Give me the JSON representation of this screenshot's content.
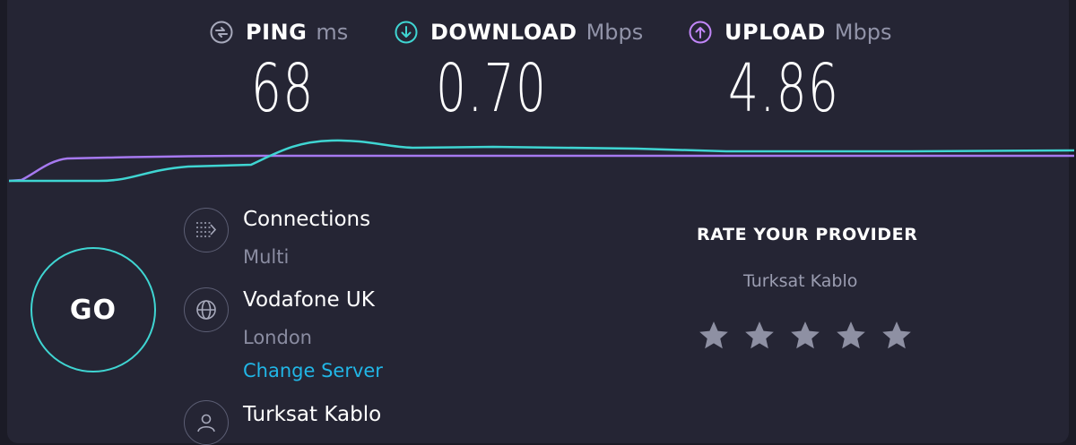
{
  "metrics": {
    "ping": {
      "label": "PING",
      "unit": "ms",
      "value": "68",
      "icon": "ping-icon",
      "color": "#a7a9bb"
    },
    "download": {
      "label": "DOWNLOAD",
      "unit": "Mbps",
      "value": "0.70",
      "icon": "download-arrow-icon",
      "color": "#3fd5d2"
    },
    "upload": {
      "label": "UPLOAD",
      "unit": "Mbps",
      "value": "4.86",
      "icon": "upload-arrow-icon",
      "color": "#c186f8"
    }
  },
  "go_label": "GO",
  "connections": {
    "title": "Connections",
    "value": "Multi",
    "icon": "connections-icon"
  },
  "server": {
    "name": "Vodafone UK",
    "location": "London",
    "change_label": "Change Server",
    "icon": "globe-icon"
  },
  "isp": {
    "name": "Turksat Kablo",
    "icon": "user-icon"
  },
  "rating": {
    "title": "RATE YOUR PROVIDER",
    "provider": "Turksat Kablo",
    "stars": 5,
    "filled": 0
  },
  "colors": {
    "download": "#3fd5d2",
    "upload": "#a679f0",
    "link": "#21b6e6",
    "background": "#252534"
  }
}
